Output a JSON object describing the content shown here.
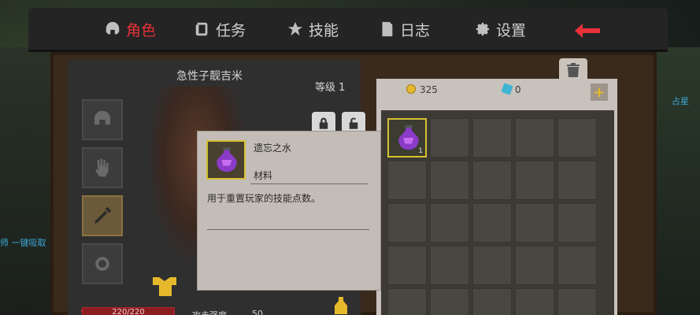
{
  "tabs": [
    {
      "label": "角色",
      "icon": "helmet-icon",
      "active": true
    },
    {
      "label": "任务",
      "icon": "scroll-icon",
      "active": false
    },
    {
      "label": "技能",
      "icon": "skill-icon",
      "active": false
    },
    {
      "label": "日志",
      "icon": "journal-icon",
      "active": false
    },
    {
      "label": "设置",
      "icon": "gear-icon",
      "active": false
    }
  ],
  "character": {
    "name": "急性子靓吉米",
    "level": "等级 1",
    "hp": "220/220",
    "attack_label": "攻击强度",
    "attack_value": "50"
  },
  "currency": {
    "gold": "325",
    "gems": "0"
  },
  "inventory": {
    "items": [
      {
        "slot": 0,
        "icon": "purple-potion-icon",
        "count": "1"
      }
    ]
  },
  "tooltip": {
    "name": "遗忘之水",
    "type": "材料",
    "description": "用于重置玩家的技能点数。"
  },
  "world": {
    "left_text": "师 一键吸取",
    "right_text": "占星"
  },
  "colors": {
    "accent_red": "#e8313a",
    "gold": "#e6b92c",
    "gem_blue": "#3fb4d4",
    "item_border": "#d4c130"
  }
}
